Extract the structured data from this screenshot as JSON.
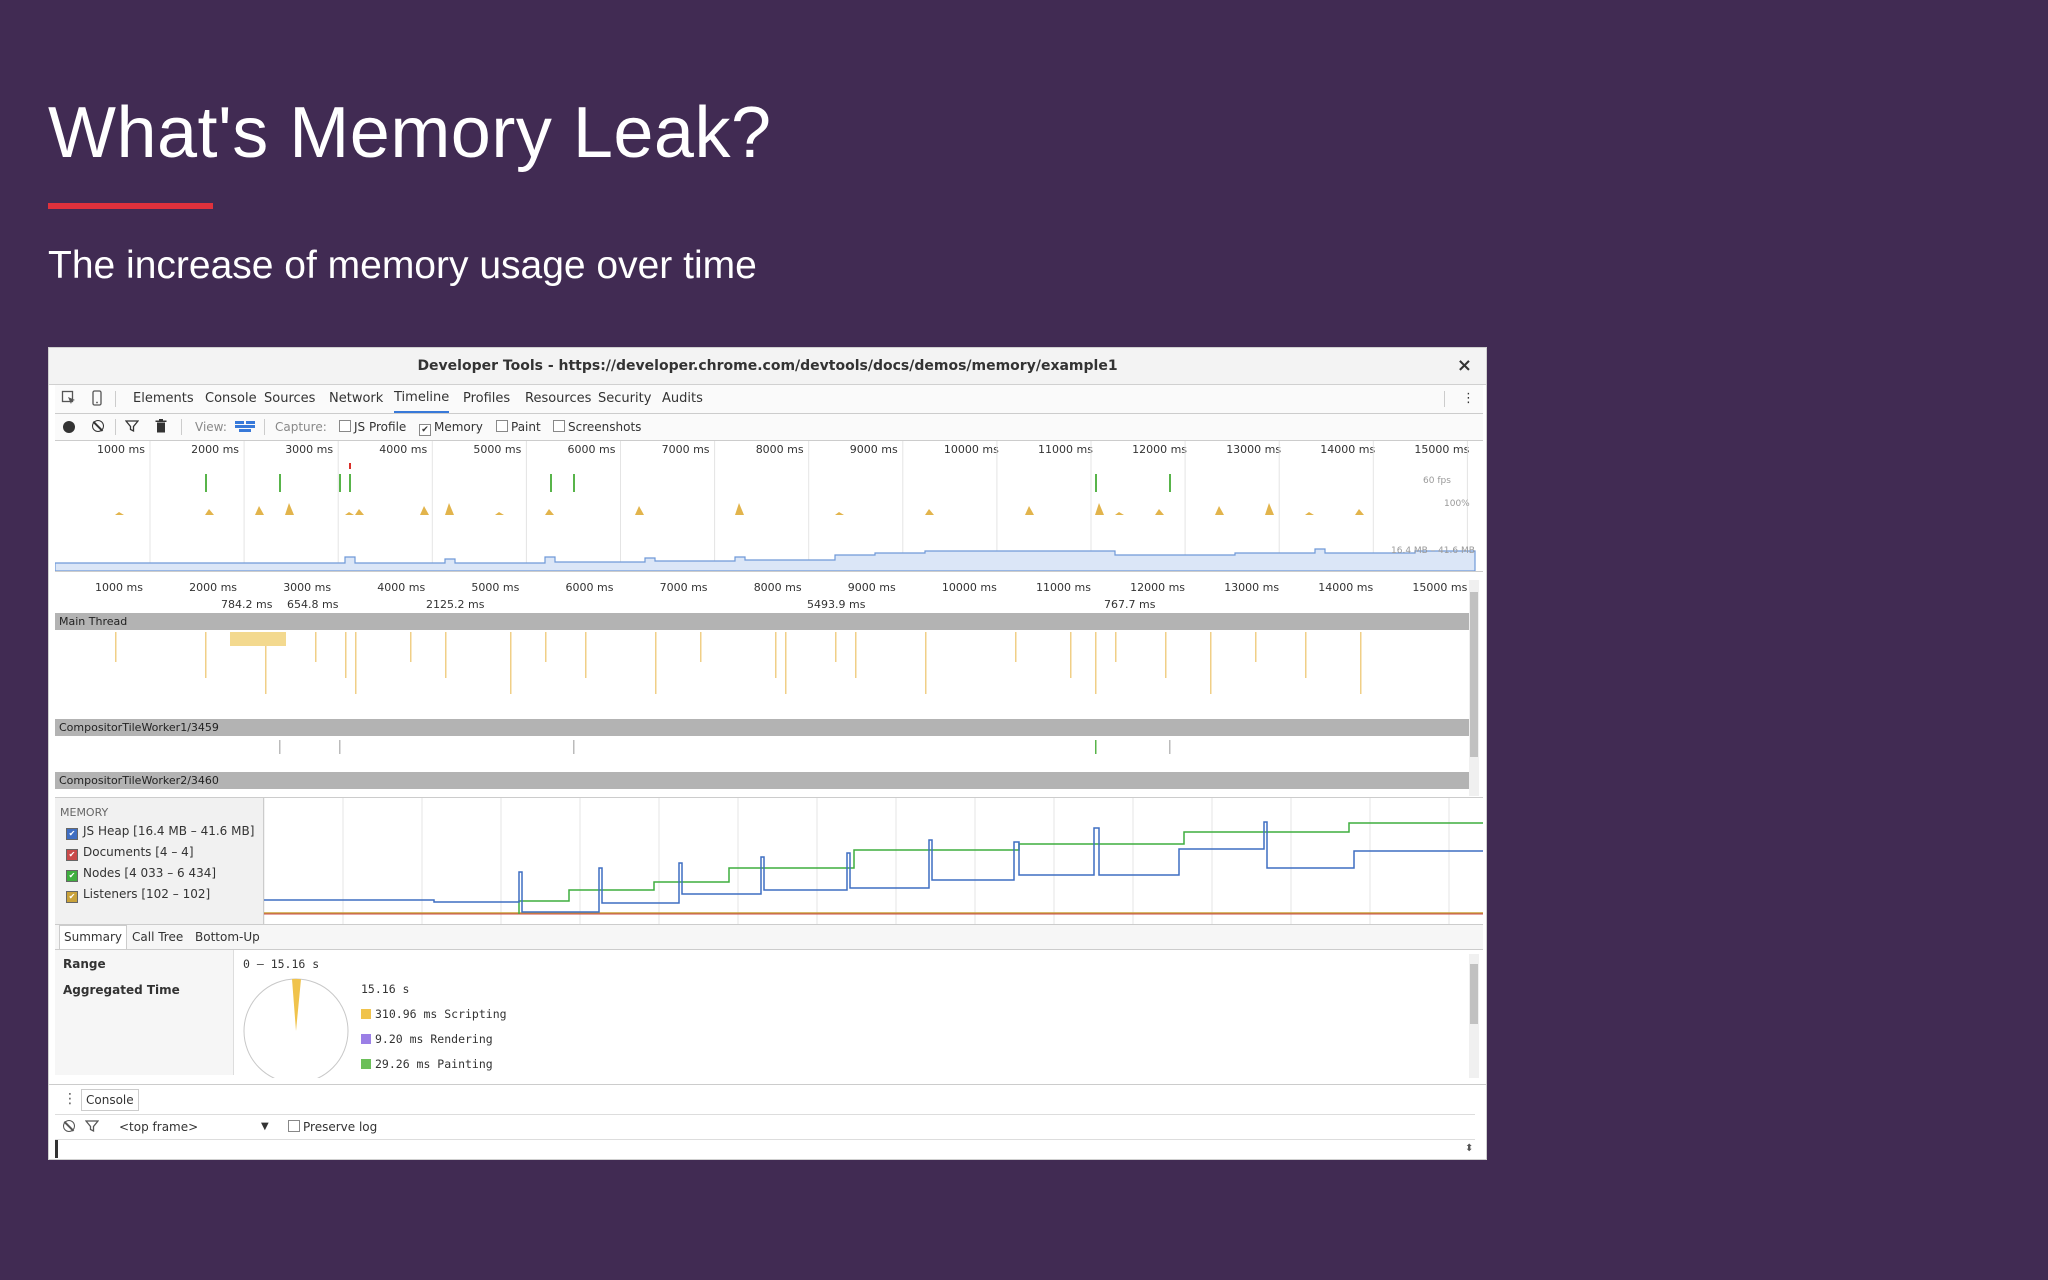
{
  "slide": {
    "title": "What's Memory Leak?",
    "subtitle": "The increase of memory usage over time",
    "accent_color": "#e0313c",
    "background_color": "#412b53"
  },
  "window": {
    "title": "Developer Tools - https://developer.chrome.com/devtools/docs/demos/memory/example1",
    "close_icon": "×"
  },
  "tabs": {
    "icons": [
      "inspect-icon",
      "device-icon"
    ],
    "items": [
      "Elements",
      "Console",
      "Sources",
      "Network",
      "Timeline",
      "Profiles",
      "Resources",
      "Security",
      "Audits"
    ],
    "active": "Timeline",
    "more_icon": "⋮"
  },
  "toolbar": {
    "view_label": "View:",
    "capture_label": "Capture:",
    "js_profile": "JS Profile",
    "memory": "Memory",
    "paint": "Paint",
    "screenshots": "Screenshots",
    "memory_checked": true
  },
  "ruler": {
    "ticks": [
      "1000 ms",
      "2000 ms",
      "3000 ms",
      "4000 ms",
      "5000 ms",
      "6000 ms",
      "7000 ms",
      "8000 ms",
      "9000 ms",
      "10000 ms",
      "11000 ms",
      "12000 ms",
      "13000 ms",
      "14000 ms",
      "15000 ms"
    ]
  },
  "overview": {
    "fps_label": "60 fps",
    "cpu_label": "100%",
    "heap_label": "16.4 MB – 41.6 MB"
  },
  "durations": [
    "784.2 ms",
    "654.8 ms",
    "2125.2 ms",
    "5493.9 ms",
    "767.7 ms"
  ],
  "threads": [
    "Main Thread",
    "CompositorTileWorker1/3459",
    "CompositorTileWorker2/3460"
  ],
  "memory": {
    "header": "MEMORY",
    "counters": [
      {
        "label": "JS Heap [16.4 MB – 41.6 MB]",
        "color": "#3f6ec2"
      },
      {
        "label": "Documents [4 – 4]",
        "color": "#c94a4a"
      },
      {
        "label": "Nodes [4 033 – 6 434]",
        "color": "#3fae3f"
      },
      {
        "label": "Listeners [102 – 102]",
        "color": "#c9a23a"
      }
    ]
  },
  "summary_tabs": [
    "Summary",
    "Call Tree",
    "Bottom-Up"
  ],
  "summary": {
    "range_label": "Range",
    "range_value": "0 – 15.16 s",
    "aggregated_label": "Aggregated Time",
    "total": "15.16 s",
    "legend": [
      {
        "label": "310.96 ms Scripting",
        "color": "#f0c34c"
      },
      {
        "label": "9.20 ms Rendering",
        "color": "#9b7fe6"
      },
      {
        "label": "29.26 ms Painting",
        "color": "#6bbf59"
      }
    ]
  },
  "console": {
    "tab": "Console",
    "frame": "<top frame>",
    "preserve_log": "Preserve log"
  }
}
